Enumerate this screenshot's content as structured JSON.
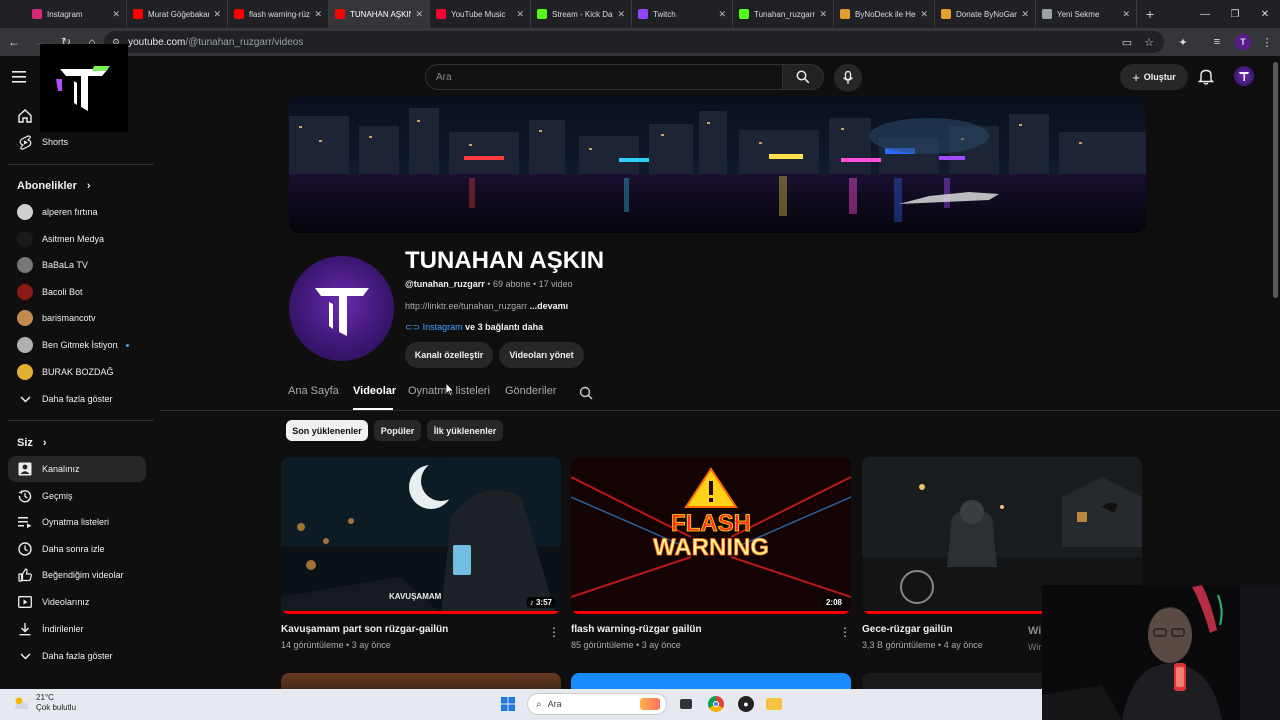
{
  "browser": {
    "tabs": [
      {
        "label": "Instagram",
        "icon": "instagram-icon",
        "color": "#d62976"
      },
      {
        "label": "Murat Göğebakan",
        "icon": "youtube-icon",
        "color": "#ff0000"
      },
      {
        "label": "flash warning-rüzgar",
        "icon": "youtube-icon",
        "color": "#ff0000"
      },
      {
        "label": "TUNAHAN AŞKIN",
        "icon": "youtube-icon",
        "color": "#ff0000"
      },
      {
        "label": "YouTube Music",
        "icon": "youtube-music-icon",
        "color": "#ff0033"
      },
      {
        "label": "Stream - Kick Dashboard",
        "icon": "kick-icon",
        "color": "#53fc18"
      },
      {
        "label": "Twitch",
        "icon": "twitch-icon",
        "color": "#9146ff"
      },
      {
        "label": "Tunahan_ruzgarr",
        "icon": "kick-icon",
        "color": "#53fc18"
      },
      {
        "label": "ByNoDeck ile Hediye",
        "icon": "bynodeck-icon",
        "color": "#e0a030"
      },
      {
        "label": "Donate ByNoGame",
        "icon": "bynogame-icon",
        "color": "#e0a030"
      },
      {
        "label": "Yeni Sekme",
        "icon": "chrome-icon",
        "color": "#9aa0a6"
      }
    ],
    "active_tab": 3,
    "new_tab": "+",
    "url_host": "youtube.com",
    "url_path": "/@tunahan_ruzgarr/videos",
    "profile_letter": "T"
  },
  "masthead": {
    "search_placeholder": "Ara",
    "create_label": "Oluştur"
  },
  "sidebar": {
    "top": [
      {
        "label": "",
        "icon": "home-icon"
      },
      {
        "label": "Shorts",
        "icon": "shorts-icon"
      }
    ],
    "subs_heading": "Abonelikler",
    "subscriptions": [
      {
        "label": "alperen fırtına",
        "color": "#cfcfcf"
      },
      {
        "label": "Asitmen Medya",
        "color": "#1a1a1a"
      },
      {
        "label": "BaBaLa TV",
        "color": "#777777"
      },
      {
        "label": "Bacoli Bot",
        "color": "#8a1a1a"
      },
      {
        "label": "barismancotv",
        "color": "#c08a50"
      },
      {
        "label": "Ben Gitmek İstiyorum",
        "color": "#b0b0b0",
        "new": true
      },
      {
        "label": "BURAK BOZDAĞ",
        "color": "#e0b030"
      }
    ],
    "subs_more": "Daha fazla göster",
    "you_heading": "Siz",
    "you_items": [
      {
        "label": "Kanalınız",
        "icon": "channel-icon",
        "active": true
      },
      {
        "label": "Geçmiş",
        "icon": "history-icon"
      },
      {
        "label": "Oynatma listeleri",
        "icon": "playlist-icon"
      },
      {
        "label": "Daha sonra izle",
        "icon": "clock-icon"
      },
      {
        "label": "Beğendiğim videolar",
        "icon": "like-icon"
      },
      {
        "label": "Videolarınız",
        "icon": "video-icon"
      },
      {
        "label": "İndirilenler",
        "icon": "download-icon"
      },
      {
        "label": "Daha fazla göster",
        "icon": "chevron-down-icon"
      }
    ]
  },
  "channel": {
    "name": "TUNAHAN AŞKIN",
    "handle": "@tunahan_ruzgarr",
    "meta": " • 69 abone • 17 video",
    "desc": "http://linktr.ee/tunahan_ruzgarr ",
    "desc_more": "...devamı",
    "link_main": "Instagram",
    "link_more": " ve 3 bağlantı daha",
    "btn_customize": "Kanalı özelleştir",
    "btn_manage": "Videoları yönet",
    "tabs": [
      "Ana Sayfa",
      "Videolar",
      "Oynatma listeleri",
      "Gönderiler"
    ],
    "active_tab": 1
  },
  "chips": [
    {
      "label": "Son yüklenenler",
      "active": true
    },
    {
      "label": "Popüler",
      "active": false
    },
    {
      "label": "İlk yüklenenler",
      "active": false
    }
  ],
  "videos": [
    {
      "title": "Kavuşamam part son rüzgar-gailün",
      "meta": "14 görüntüleme • 3 ay önce",
      "duration": "3:57",
      "overlay": "KAVUŞAMAM",
      "progress": 1.0
    },
    {
      "title": "flash warning-rüzgar gailün",
      "meta": "85 görüntüleme • 3 ay önce",
      "duration": "2:08",
      "overlay": "FLASH WARNING",
      "progress": 1.0
    },
    {
      "title": "Gece-rüzgar gailün",
      "meta": "3,3 B görüntüleme • 4 ay önce",
      "duration": "",
      "overlay": "",
      "progress": 1.0
    }
  ],
  "cropped_text": [
    "Wi",
    "Wir"
  ],
  "taskbar": {
    "temp": "21°C",
    "weather": "Çok bulutlu",
    "search_placeholder": "Ara"
  }
}
